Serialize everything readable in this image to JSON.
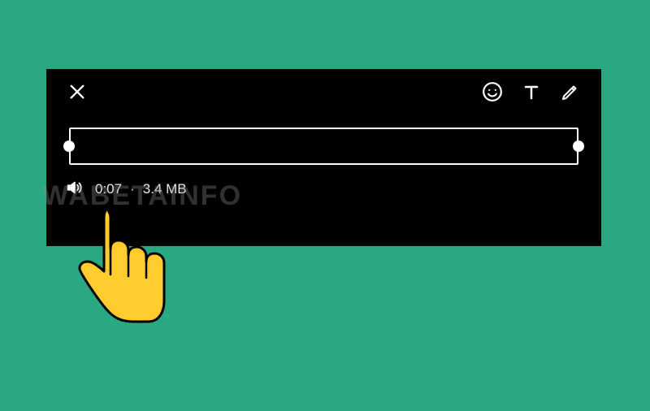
{
  "toolbar": {
    "close_label": "Close",
    "emoji_label": "Emoji",
    "text_label": "Text",
    "draw_label": "Draw"
  },
  "media": {
    "duration": "0:07",
    "separator": "·",
    "size": "3.4 MB"
  },
  "watermark": "WABETAINFO"
}
